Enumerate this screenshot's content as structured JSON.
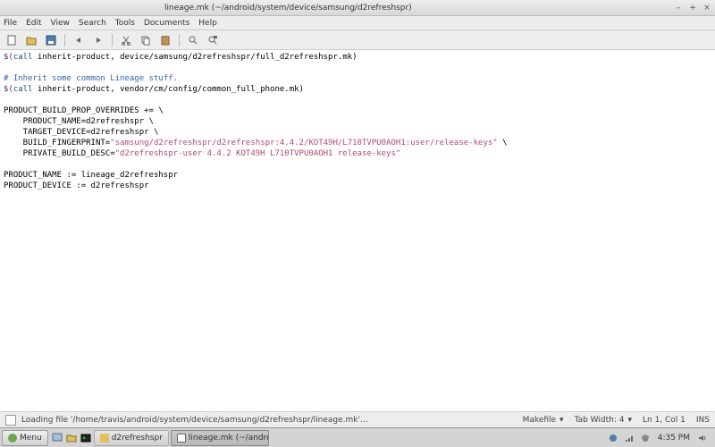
{
  "window": {
    "title": "lineage.mk (~/android/system/device/samsung/d2refreshspr)"
  },
  "menubar": [
    "File",
    "Edit",
    "View",
    "Search",
    "Tools",
    "Documents",
    "Help"
  ],
  "code": {
    "l1a": "$(",
    "l1b": "call",
    "l1c": " inherit-product, device/samsung/d2refreshspr/full_d2refreshspr.mk)",
    "l2": "# Inherit some common Lineage stuff.",
    "l3a": "$(",
    "l3b": "call",
    "l3c": " inherit-product, vendor/cm/config/common_full_phone.mk)",
    "l4": "PRODUCT_BUILD_PROP_OVERRIDES += \\",
    "l5a": "    PRODUCT_NAME=",
    "l5b": "d2refreshspr",
    "l5c": " \\",
    "l6a": "    TARGET_DEVICE=",
    "l6b": "d2refreshspr",
    "l6c": " \\",
    "l7a": "    BUILD_FINGERPRINT=",
    "l7b": "\"samsung/d2refreshspr/d2refreshspr:4.4.2/KOT49H/L710TVPU0AOH1:user/release-keys\"",
    "l7c": " \\",
    "l8a": "    PRIVATE_BUILD_DESC=",
    "l8b": "\"d2refreshspr-user 4.4.2 KOT49H L710TVPU0AOH1 release-keys\"",
    "l9": "PRODUCT_NAME := lineage_d2refreshspr",
    "l10": "PRODUCT_DEVICE := d2refreshspr"
  },
  "status": {
    "message": "Loading file '/home/travis/android/system/device/samsung/d2refreshspr/lineage.mk'...",
    "lang": "Makefile",
    "tabwidth": "Tab Width: 4",
    "position": "Ln 1, Col 1",
    "mode": "INS"
  },
  "taskbar": {
    "menu": "Menu",
    "items": [
      {
        "label": "d2refreshspr",
        "active": false
      },
      {
        "label": "lineage.mk (~/androi...",
        "active": true
      }
    ],
    "time": "4:35 PM"
  }
}
